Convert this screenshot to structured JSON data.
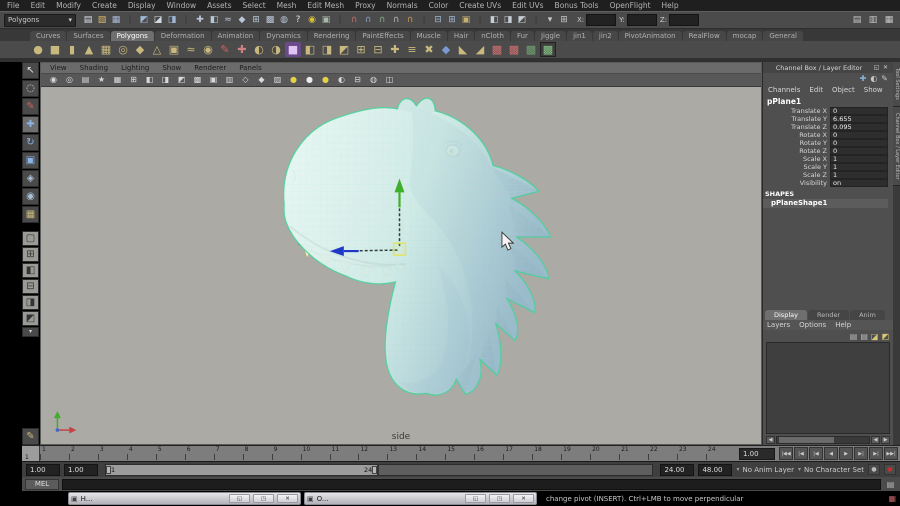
{
  "menubar": {
    "items": [
      "File",
      "Edit",
      "Modify",
      "Create",
      "Display",
      "Window",
      "Assets",
      "Select",
      "Mesh",
      "Edit Mesh",
      "Proxy",
      "Normals",
      "Color",
      "Create UVs",
      "Edit UVs",
      "Bonus Tools",
      "OpenFlight",
      "Help"
    ]
  },
  "statusline": {
    "mode": "Polygons",
    "dropdown_arrow": "▾",
    "icons": [
      {
        "name": "new-scene-icon",
        "glyph": "▤",
        "style": "color:#dde2e8"
      },
      {
        "name": "open-scene-icon",
        "glyph": "▧",
        "style": "color:#d4b96a"
      },
      {
        "name": "save-scene-icon",
        "glyph": "▦",
        "style": "color:#a9bcd6"
      },
      {
        "name": "divider",
        "glyph": "|",
        "style": "color:#353535"
      },
      {
        "name": "select-by-hierarchy-icon",
        "glyph": "◩",
        "style": "color:#9fb6d4"
      },
      {
        "name": "select-by-object-icon",
        "glyph": "◪",
        "style": "color:#d4dae2"
      },
      {
        "name": "select-by-component-icon",
        "glyph": "◨",
        "style": "color:#9fb6d4"
      },
      {
        "name": "divider",
        "glyph": "|",
        "style": "color:#353535"
      },
      {
        "name": "select-mask-handles-icon",
        "glyph": "✚",
        "style": "color:#b9c6d8"
      },
      {
        "name": "select-mask-joints-icon",
        "glyph": "◧",
        "style": "color:#b9c6d8"
      },
      {
        "name": "select-mask-curves-icon",
        "glyph": "≈",
        "style": "color:#b9c6d8"
      },
      {
        "name": "select-mask-surfaces-icon",
        "glyph": "◆",
        "style": "color:#b9c6d8"
      },
      {
        "name": "select-mask-deformations-icon",
        "glyph": "⊞",
        "style": "color:#b9c6d8"
      },
      {
        "name": "select-mask-dynamics-icon",
        "glyph": "▩",
        "style": "color:#b9c6d8"
      },
      {
        "name": "select-mask-misc-icon",
        "glyph": "◍",
        "style": "color:#b9c6d8"
      },
      {
        "name": "select-mask-help-icon",
        "glyph": "?",
        "style": "color:#e0e0e0"
      },
      {
        "name": "lock-selection-icon",
        "glyph": "◉",
        "style": "color:#d8c23a"
      },
      {
        "name": "highlight-selection-icon",
        "glyph": "▣",
        "style": "color:#a8b8a8"
      },
      {
        "name": "divider",
        "glyph": "|",
        "style": "color:#353535"
      },
      {
        "name": "snap-to-grid-icon",
        "glyph": "∩",
        "style": "color:#c87070"
      },
      {
        "name": "snap-to-curve-icon",
        "glyph": "∩",
        "style": "color:#8aa0c8"
      },
      {
        "name": "snap-to-point-icon",
        "glyph": "∩",
        "style": "color:#88b088"
      },
      {
        "name": "snap-to-view-plane-icon",
        "glyph": "∩",
        "style": "color:#b8b8b8"
      },
      {
        "name": "make-live-icon",
        "glyph": "∩",
        "style": "color:#c89858"
      },
      {
        "name": "divider",
        "glyph": "|",
        "style": "color:#353535"
      },
      {
        "name": "input-connections-icon",
        "glyph": "⊟",
        "style": "color:#9fb6d4"
      },
      {
        "name": "output-connections-icon",
        "glyph": "⊞",
        "style": "color:#9fb6d4"
      },
      {
        "name": "construction-history-icon",
        "glyph": "▣",
        "style": "color:#c8b070"
      },
      {
        "name": "divider",
        "glyph": "|",
        "style": "color:#353535"
      },
      {
        "name": "render-view-icon",
        "glyph": "◧",
        "style": "color:#c4ccd4"
      },
      {
        "name": "ipr-render-icon",
        "glyph": "◨",
        "style": "color:#c4ccd4"
      },
      {
        "name": "render-settings-icon",
        "glyph": "◩",
        "style": "color:#c4ccd4"
      },
      {
        "name": "divider",
        "glyph": "|",
        "style": "color:#353535"
      },
      {
        "name": "input-line-mode-icon",
        "glyph": "▾",
        "style": "color:#c8c8c8"
      },
      {
        "name": "absolute-transform-icon",
        "glyph": "⊞",
        "style": "color:#c8c8c8"
      }
    ],
    "coords": [
      {
        "label": "X:"
      },
      {
        "label": "Y:"
      },
      {
        "label": "Z:"
      }
    ],
    "right_icons": [
      {
        "name": "show-attribute-editor-icon",
        "glyph": "▤",
        "style": "color:#c8c8c8"
      },
      {
        "name": "show-tool-settings-icon",
        "glyph": "▥",
        "style": "color:#c8c8c8"
      },
      {
        "name": "show-channel-box-icon",
        "glyph": "▦",
        "style": "color:#c8c8c8"
      }
    ]
  },
  "shelf": {
    "tabs": [
      {
        "label": "Curves",
        "name": "shelf-tab-curves",
        "cls": "shelf-tab"
      },
      {
        "label": "Surfaces",
        "name": "shelf-tab-surfaces",
        "cls": "shelf-tab"
      },
      {
        "label": "Polygons",
        "name": "shelf-tab-polygons",
        "cls": "shelf-tab active"
      },
      {
        "label": "Deformation",
        "name": "shelf-tab-deformation",
        "cls": "shelf-tab"
      },
      {
        "label": "Animation",
        "name": "shelf-tab-animation",
        "cls": "shelf-tab"
      },
      {
        "label": "Dynamics",
        "name": "shelf-tab-dynamics",
        "cls": "shelf-tab"
      },
      {
        "label": "Rendering",
        "name": "shelf-tab-rendering",
        "cls": "shelf-tab"
      },
      {
        "label": "PaintEffects",
        "name": "shelf-tab-painteffects",
        "cls": "shelf-tab"
      },
      {
        "label": "Muscle",
        "name": "shelf-tab-muscle",
        "cls": "shelf-tab"
      },
      {
        "label": "Hair",
        "name": "shelf-tab-hair",
        "cls": "shelf-tab"
      },
      {
        "label": "nCloth",
        "name": "shelf-tab-ncloth",
        "cls": "shelf-tab"
      },
      {
        "label": "Fur",
        "name": "shelf-tab-fur",
        "cls": "shelf-tab"
      },
      {
        "label": "Jiggle",
        "name": "shelf-tab-jiggle",
        "cls": "shelf-tab"
      },
      {
        "label": "jin1",
        "name": "shelf-tab-jin1",
        "cls": "shelf-tab"
      },
      {
        "label": "jin2",
        "name": "shelf-tab-jin2",
        "cls": "shelf-tab"
      },
      {
        "label": "PivotAnimaton",
        "name": "shelf-tab-pivotanimaton",
        "cls": "shelf-tab"
      },
      {
        "label": "RealFlow",
        "name": "shelf-tab-realflow",
        "cls": "shelf-tab"
      },
      {
        "label": "mocap",
        "name": "shelf-tab-mocap",
        "cls": "shelf-tab"
      },
      {
        "label": "General",
        "name": "shelf-tab-general",
        "cls": "shelf-tab"
      }
    ],
    "icons": [
      {
        "name": "poly-sphere-icon",
        "glyph": "●",
        "style": "color:#c9b97e"
      },
      {
        "name": "poly-cube-icon",
        "glyph": "■",
        "style": "color:#c9b97e"
      },
      {
        "name": "poly-cylinder-icon",
        "glyph": "▮",
        "style": "color:#c9b97e"
      },
      {
        "name": "poly-cone-icon",
        "glyph": "▲",
        "style": "color:#c9b97e"
      },
      {
        "name": "poly-plane-icon",
        "glyph": "▦",
        "style": "color:#c9b97e"
      },
      {
        "name": "poly-torus-icon",
        "glyph": "◎",
        "style": "color:#c9b97e"
      },
      {
        "name": "poly-prism-icon",
        "glyph": "◆",
        "style": "color:#c9b97e"
      },
      {
        "name": "poly-pyramid-icon",
        "glyph": "△",
        "style": "color:#c9b97e"
      },
      {
        "name": "poly-pipe-icon",
        "glyph": "▣",
        "style": "color:#c9b97e"
      },
      {
        "name": "poly-helix-icon",
        "glyph": "≈",
        "style": "color:#c9b97e"
      },
      {
        "name": "poly-soccerball-icon",
        "glyph": "◉",
        "style": "color:#c9b97e"
      },
      {
        "name": "curve-tool-icon",
        "glyph": "✎",
        "style": "color:#d06060"
      },
      {
        "name": "sculpt-tool-icon",
        "glyph": "✚",
        "style": "color:#cf8080"
      },
      {
        "name": "mirror-geometry-icon",
        "glyph": "◐",
        "style": "color:#c9b97e"
      },
      {
        "name": "combine-icon",
        "glyph": "◑",
        "style": "color:#c9b97e"
      },
      {
        "name": "smooth-icon",
        "glyph": "■",
        "style": "color:#e0c4f4;background:#6a4a8a;border-radius:2px"
      },
      {
        "name": "extract-icon",
        "glyph": "◧",
        "style": "color:#c9b97e"
      },
      {
        "name": "boolean-union-icon",
        "glyph": "◨",
        "style": "color:#c9b97e"
      },
      {
        "name": "bevel-icon",
        "glyph": "◩",
        "style": "color:#c9b97e"
      },
      {
        "name": "bridge-icon",
        "glyph": "⊞",
        "style": "color:#c9b97e"
      },
      {
        "name": "extrude-icon",
        "glyph": "⊟",
        "style": "color:#c9b97e"
      },
      {
        "name": "merge-vertex-icon",
        "glyph": "✚",
        "style": "color:#c9b97e"
      },
      {
        "name": "split-polygon-icon",
        "glyph": "≡",
        "style": "color:#c9b97e"
      },
      {
        "name": "delete-edge-icon",
        "glyph": "✖",
        "style": "color:#c9b97e"
      },
      {
        "name": "boolean-difference-icon",
        "glyph": "◆",
        "style": "color:#7a9ad0"
      },
      {
        "name": "triangulate-icon",
        "glyph": "◣",
        "style": "color:#c9b97e"
      },
      {
        "name": "quadrangulate-icon",
        "glyph": "◢",
        "style": "color:#c9b97e"
      },
      {
        "name": "uv-snapshot-icon",
        "glyph": "▩",
        "style": "color:#d07070"
      },
      {
        "name": "uv-texture-editor-icon",
        "glyph": "▩",
        "style": "color:#d07070"
      },
      {
        "name": "normals-display-icon",
        "glyph": "▩",
        "style": "color:#70a070"
      },
      {
        "name": "last-tool-icon",
        "glyph": "▩",
        "style": "color:#88c888;border:1px solid #222;background:#3e3e3e"
      }
    ]
  },
  "toolbox": {
    "tools": [
      {
        "name": "select-tool",
        "glyph": "↖",
        "style": "color:#e0e0e0",
        "cls": "tool"
      },
      {
        "name": "lasso-select-tool",
        "glyph": "◌",
        "style": "color:#e0e0e0",
        "cls": "tool"
      },
      {
        "name": "paint-select-tool",
        "glyph": "✎",
        "style": "color:#d06060",
        "cls": "tool"
      },
      {
        "name": "move-tool",
        "glyph": "✚",
        "style": "color:#8ab4e8",
        "cls": "tool active"
      },
      {
        "name": "rotate-tool",
        "glyph": "↻",
        "style": "color:#8ab4e8",
        "cls": "tool"
      },
      {
        "name": "scale-tool",
        "glyph": "▣",
        "style": "color:#8ab4e8",
        "cls": "tool"
      },
      {
        "name": "universal-manipulator-tool",
        "glyph": "◈",
        "style": "color:#a8c0d8",
        "cls": "tool"
      },
      {
        "name": "soft-modification-tool",
        "glyph": "◉",
        "style": "color:#a8c0d8",
        "cls": "tool"
      },
      {
        "name": "current-tool",
        "glyph": "▦",
        "style": "color:#c9b97e",
        "cls": "tool"
      }
    ],
    "layouts": [
      {
        "name": "layout-single-pane-button",
        "glyph": "▢",
        "style": "",
        "cls": "tool layout"
      },
      {
        "name": "layout-four-pane-button",
        "glyph": "⊞",
        "style": "",
        "cls": "tool layout"
      },
      {
        "name": "layout-persp-outliner-button",
        "glyph": "◧",
        "style": "",
        "cls": "tool layout"
      },
      {
        "name": "layout-persp-graph-button",
        "glyph": "⊟",
        "style": "",
        "cls": "tool layout"
      },
      {
        "name": "layout-hypershade-button",
        "glyph": "◨",
        "style": "",
        "cls": "tool layout"
      },
      {
        "name": "layout-persp-multi-button",
        "glyph": "◩",
        "style": "",
        "cls": "tool layout"
      }
    ],
    "more_arrow": "▾",
    "bottom_tool_glyph": "✎"
  },
  "viewport": {
    "menus": [
      "View",
      "Shading",
      "Lighting",
      "Show",
      "Renderer",
      "Panels"
    ],
    "toolbar_icons": [
      {
        "name": "select-camera-icon",
        "glyph": "◉",
        "style": "color:#d8d8d8"
      },
      {
        "name": "lock-camera-icon",
        "glyph": "◎",
        "style": "color:#d8d8d8"
      },
      {
        "name": "camera-attributes-icon",
        "glyph": "▤",
        "style": "color:#d8d8d8"
      },
      {
        "name": "bookmark-icon",
        "glyph": "★",
        "style": "color:#d8d8d8"
      },
      {
        "name": "image-plane-icon",
        "glyph": "▦",
        "style": "color:#d8d8d8"
      },
      {
        "name": "view-grid-icon",
        "glyph": "⊞",
        "style": "color:#d8d8d8"
      },
      {
        "name": "film-gate-icon",
        "glyph": "◧",
        "style": "color:#d8d8d8"
      },
      {
        "name": "resolution-gate-icon",
        "glyph": "◨",
        "style": "color:#d8d8d8"
      },
      {
        "name": "gate-mask-icon",
        "glyph": "◩",
        "style": "color:#d8d8d8"
      },
      {
        "name": "field-chart-icon",
        "glyph": "▩",
        "style": "color:#d8d8d8"
      },
      {
        "name": "safe-action-icon",
        "glyph": "▣",
        "style": "color:#d8d8d8"
      },
      {
        "name": "safe-title-icon",
        "glyph": "▥",
        "style": "color:#d8d8d8"
      },
      {
        "name": "wireframe-icon",
        "glyph": "◇",
        "style": "color:#d8d8d8"
      },
      {
        "name": "shaded-icon",
        "glyph": "◆",
        "style": "color:#d8d8d8"
      },
      {
        "name": "textured-icon",
        "glyph": "▨",
        "style": "color:#d8d8d8"
      },
      {
        "name": "default-lighting-icon",
        "glyph": "●",
        "style": "color:#e2d247"
      },
      {
        "name": "flat-lighting-icon",
        "glyph": "●",
        "style": "color:#ececec"
      },
      {
        "name": "all-lights-icon",
        "glyph": "●",
        "style": "color:#e2d247"
      },
      {
        "name": "shadows-icon",
        "glyph": "◐",
        "style": "color:#d8d8d8"
      },
      {
        "name": "isolate-select-icon",
        "glyph": "⊟",
        "style": "color:#d8d8d8"
      },
      {
        "name": "xray-icon",
        "glyph": "◍",
        "style": "color:#d8d8d8"
      },
      {
        "name": "exposure-icon",
        "glyph": "◫",
        "style": "color:#d8d8d8"
      }
    ],
    "camera_label": "side"
  },
  "channel_box": {
    "title": "Channel Box / Layer Editor",
    "title_icons": [
      {
        "name": "float-panel-icon",
        "glyph": "◱"
      },
      {
        "name": "close-panel-icon",
        "glyph": "✕"
      }
    ],
    "tool_icons": [
      {
        "name": "manip-attach-icon",
        "glyph": "✚",
        "style": "color:#8ab0d8"
      },
      {
        "name": "speed-dial-icon",
        "glyph": "◐",
        "style": "color:#c8c8c8"
      },
      {
        "name": "hyperbolic-pencil-icon",
        "glyph": "✎",
        "style": "color:#c8c8c8"
      }
    ],
    "menus": [
      "Channels",
      "Edit",
      "Object",
      "Show"
    ],
    "object_name": "pPlane1",
    "channels": [
      {
        "label": "Translate X",
        "value": "0"
      },
      {
        "label": "Translate Y",
        "value": "6.655"
      },
      {
        "label": "Translate Z",
        "value": "0.095"
      },
      {
        "label": "Rotate X",
        "value": "0"
      },
      {
        "label": "Rotate Y",
        "value": "0"
      },
      {
        "label": "Rotate Z",
        "value": "0"
      },
      {
        "label": "Scale X",
        "value": "1"
      },
      {
        "label": "Scale Y",
        "value": "1"
      },
      {
        "label": "Scale Z",
        "value": "1"
      },
      {
        "label": "Visibility",
        "value": "on"
      }
    ],
    "shapes_header": "SHAPES",
    "shape_name": "pPlaneShape1",
    "side_tabs": [
      "Tool Settings",
      "Channel Box / Layer Editor"
    ]
  },
  "layer_editor": {
    "tabs": [
      {
        "label": "Display",
        "name": "layer-tab-display",
        "cls": "le-tab active"
      },
      {
        "label": "Render",
        "name": "layer-tab-render",
        "cls": "le-tab"
      },
      {
        "label": "Anim",
        "name": "layer-tab-anim",
        "cls": "le-tab"
      }
    ],
    "menus": [
      "Layers",
      "Options",
      "Help"
    ],
    "icons": [
      {
        "name": "move-layer-up-icon",
        "glyph": "▤",
        "style": "color:#b8b8b8"
      },
      {
        "name": "move-layer-down-icon",
        "glyph": "▤",
        "style": "color:#b8b8b8"
      },
      {
        "name": "create-empty-layer-icon",
        "glyph": "◪",
        "style": "color:#d8c878"
      },
      {
        "name": "create-layer-from-selected-icon",
        "glyph": "◩",
        "style": "color:#d8c878"
      }
    ]
  },
  "timeline": {
    "ticks": [
      "1",
      "2",
      "3",
      "4",
      "5",
      "6",
      "7",
      "8",
      "9",
      "10",
      "11",
      "12",
      "13",
      "14",
      "15",
      "16",
      "17",
      "18",
      "19",
      "20",
      "21",
      "22",
      "23",
      "24"
    ],
    "current_frame": "1",
    "current_time": "1.00",
    "playback": [
      {
        "name": "go-to-start-button",
        "glyph": "|◀◀"
      },
      {
        "name": "step-back-frame-button",
        "glyph": "|◀"
      },
      {
        "name": "step-back-key-button",
        "glyph": "|◀"
      },
      {
        "name": "play-backwards-button",
        "glyph": "◀"
      },
      {
        "name": "play-forwards-button",
        "glyph": "▶"
      },
      {
        "name": "step-forward-key-button",
        "glyph": "▶|"
      },
      {
        "name": "step-forward-frame-button",
        "glyph": "▶|"
      },
      {
        "name": "go-to-end-button",
        "glyph": "▶▶|"
      }
    ]
  },
  "range": {
    "anim_start": "1.00",
    "playback_start": "1.00",
    "bar_start_label": "1",
    "bar_end_label": "24",
    "playback_end": "24.00",
    "anim_end": "48.00",
    "anim_layer": "No Anim Layer",
    "character_set": "No Character Set",
    "dropdown_arrow": "▾"
  },
  "command_line": {
    "label": "MEL"
  },
  "help_line": {
    "text": "change pivot (INSERT).  Ctrl+LMB to move perpendicular"
  },
  "minimized_windows": {
    "win1": {
      "label": "H...",
      "icon": "▣",
      "restore": "◱",
      "maximize": "◳",
      "close": "✕"
    },
    "win2": {
      "label": "O...",
      "icon": "▣",
      "restore": "◱",
      "maximize": "◳",
      "close": "✕"
    }
  },
  "tray_icon": "▦",
  "colors": {
    "selection_wire": "#4fd29e",
    "manip_y_axis": "#3fae2a",
    "manip_z_axis": "#2038c8",
    "canvas": "#abaaa4"
  }
}
